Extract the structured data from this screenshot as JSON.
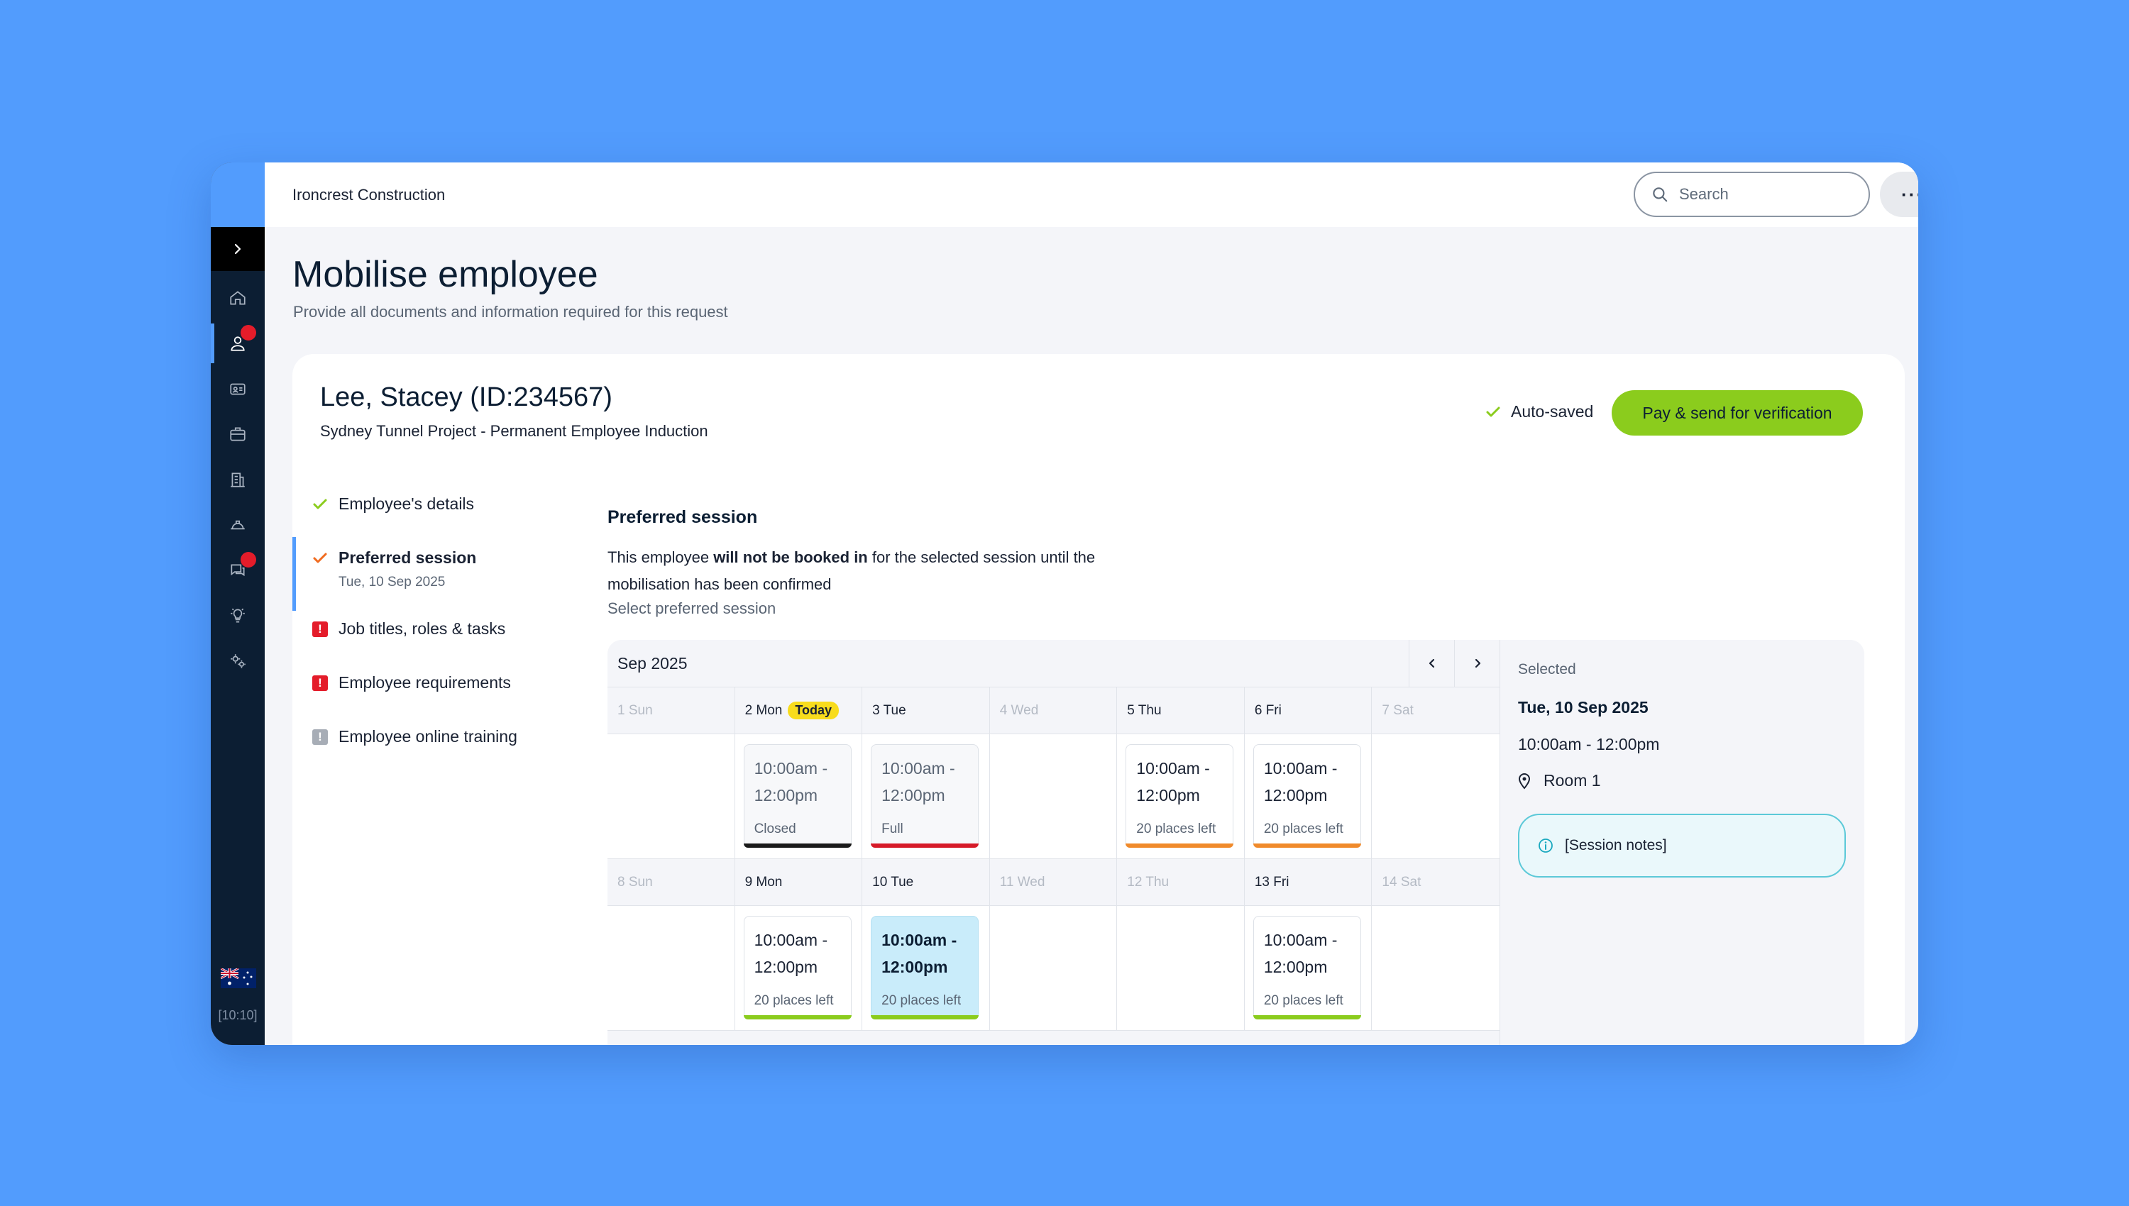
{
  "app": {
    "org_name": "Ironcrest Construction",
    "locale_flag": "australia-flag",
    "time_badge": "[10:10]"
  },
  "search": {
    "placeholder": "Search"
  },
  "more_label": "···",
  "page": {
    "title": "Mobilise employee",
    "subtitle": "Provide all documents and information required for this request"
  },
  "employee": {
    "name": "Lee, Stacey (ID:234567)",
    "project": "Sydney Tunnel Project - Permanent Employee Induction"
  },
  "status": {
    "autosaved": "Auto-saved",
    "pay_button": "Pay & send for verification"
  },
  "steps": [
    {
      "label": "Employee's details",
      "status": "complete",
      "sub": ""
    },
    {
      "label": "Preferred session",
      "status": "current",
      "sub": "Tue, 10 Sep 2025"
    },
    {
      "label": "Job titles, roles & tasks",
      "status": "error",
      "sub": ""
    },
    {
      "label": "Employee requirements",
      "status": "error",
      "sub": ""
    },
    {
      "label": "Employee online training",
      "status": "incomplete",
      "sub": ""
    }
  ],
  "section": {
    "title": "Preferred session",
    "desc_1": "This employee ",
    "desc_bold": "will not be booked in",
    "desc_2": " for the selected session until the mobilisation has been confirmed",
    "select_label": "Select preferred session"
  },
  "calendar": {
    "month": "Sep 2025",
    "today_badge": "Today",
    "weeks": [
      {
        "days": [
          {
            "label": "1 Sun",
            "muted": true
          },
          {
            "label": "2 Mon",
            "today": true
          },
          {
            "label": "3 Tue"
          },
          {
            "label": "4 Wed",
            "muted": true
          },
          {
            "label": "5 Thu"
          },
          {
            "label": "6 Fri"
          },
          {
            "label": "7 Sat",
            "muted": true
          }
        ],
        "sessions": [
          null,
          {
            "time": "10:00am - 12:00pm",
            "status": "Closed",
            "bar": "#1a1a1a",
            "dim": true
          },
          {
            "time": "10:00am - 12:00pm",
            "status": "Full",
            "bar": "#d61a28",
            "dim": true
          },
          null,
          {
            "time": "10:00am - 12:00pm",
            "status": "20 places left",
            "bar": "#f08a2b"
          },
          {
            "time": "10:00am - 12:00pm",
            "status": "20 places left",
            "bar": "#f08a2b"
          },
          null
        ]
      },
      {
        "days": [
          {
            "label": "8 Sun",
            "muted": true
          },
          {
            "label": "9 Mon"
          },
          {
            "label": "10 Tue"
          },
          {
            "label": "11 Wed",
            "muted": true
          },
          {
            "label": "12 Thu",
            "muted": true
          },
          {
            "label": "13 Fri"
          },
          {
            "label": "14 Sat",
            "muted": true
          }
        ],
        "sessions": [
          null,
          {
            "time": "10:00am - 12:00pm",
            "status": "20 places left",
            "bar": "#8bcc1d"
          },
          {
            "time": "10:00am - 12:00pm",
            "status": "20 places left",
            "bar": "#8bcc1d",
            "selected": true
          },
          null,
          null,
          {
            "time": "10:00am - 12:00pm",
            "status": "20 places left",
            "bar": "#8bcc1d"
          },
          null
        ]
      }
    ]
  },
  "selected": {
    "label": "Selected",
    "date": "Tue, 10 Sep 2025",
    "time": "10:00am - 12:00pm",
    "room": "Room 1",
    "notes": "[Session notes]"
  },
  "colors": {
    "accent": "#529cfd",
    "primary_button": "#8bcc1d",
    "sidebar": "#0c1e33",
    "badge": "#e41c2a"
  }
}
